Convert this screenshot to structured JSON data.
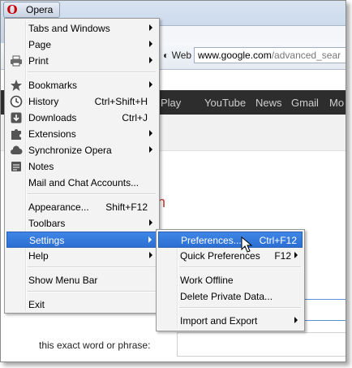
{
  "opera_button": {
    "label": "Opera"
  },
  "address": {
    "web_label": "Web",
    "url_host": "www.google.com",
    "url_rest": "/advanced_sear"
  },
  "google_bar": {
    "items": [
      "Play",
      "YouTube",
      "News",
      "Gmail",
      "Mo"
    ]
  },
  "page": {
    "red_fragment": "n",
    "exact_phrase_label": "this exact word or phrase:"
  },
  "main_menu": {
    "items": [
      {
        "label": "Tabs and Windows",
        "shortcut": "",
        "submenu": true,
        "icon": ""
      },
      {
        "label": "Page",
        "shortcut": "",
        "submenu": true,
        "icon": ""
      },
      {
        "label": "Print",
        "shortcut": "",
        "submenu": true,
        "icon": "printer-icon"
      },
      {
        "label": "Bookmarks",
        "shortcut": "",
        "submenu": true,
        "icon": "star-icon"
      },
      {
        "label": "History",
        "shortcut": "Ctrl+Shift+H",
        "submenu": false,
        "icon": "clock-icon"
      },
      {
        "label": "Downloads",
        "shortcut": "Ctrl+J",
        "submenu": false,
        "icon": "download-icon"
      },
      {
        "label": "Extensions",
        "shortcut": "",
        "submenu": true,
        "icon": "puzzle-icon"
      },
      {
        "label": "Synchronize Opera",
        "shortcut": "",
        "submenu": true,
        "icon": "cloud-icon"
      },
      {
        "label": "Notes",
        "shortcut": "",
        "submenu": false,
        "icon": "notes-icon"
      },
      {
        "label": "Mail and Chat Accounts...",
        "shortcut": "",
        "submenu": false,
        "icon": ""
      },
      {
        "label": "Appearance...",
        "shortcut": "Shift+F12",
        "submenu": false,
        "icon": ""
      },
      {
        "label": "Toolbars",
        "shortcut": "",
        "submenu": true,
        "icon": ""
      },
      {
        "label": "Settings",
        "shortcut": "",
        "submenu": true,
        "icon": "",
        "highlighted": true
      },
      {
        "label": "Help",
        "shortcut": "",
        "submenu": true,
        "icon": ""
      },
      {
        "label": "Show Menu Bar",
        "shortcut": "",
        "submenu": false,
        "icon": ""
      },
      {
        "label": "Exit",
        "shortcut": "",
        "submenu": false,
        "icon": ""
      }
    ]
  },
  "settings_menu": {
    "items": [
      {
        "label": "Preferences...",
        "shortcut": "Ctrl+F12",
        "submenu": false,
        "highlighted": true
      },
      {
        "label": "Quick Preferences",
        "shortcut": "F12",
        "submenu": true
      },
      {
        "label": "Work Offline",
        "shortcut": "",
        "submenu": false
      },
      {
        "label": "Delete Private Data...",
        "shortcut": "",
        "submenu": false
      },
      {
        "label": "Import and Export",
        "shortcut": "",
        "submenu": true
      }
    ]
  }
}
